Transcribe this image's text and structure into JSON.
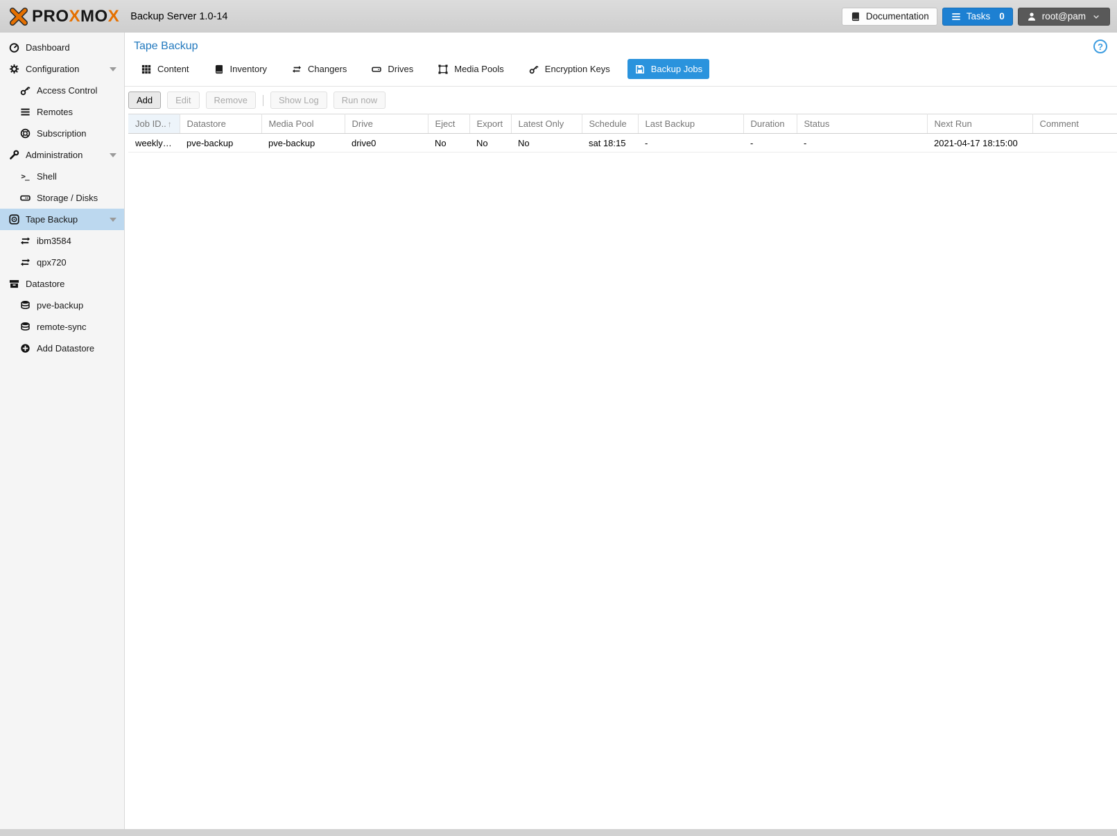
{
  "topbar": {
    "brand_p1": "PR",
    "brand_o1": "O",
    "brand_x1": "X",
    "brand_m": "M",
    "brand_o2": "O",
    "brand_x2": "X",
    "app_title": "Backup Server 1.0-14",
    "documentation_label": "Documentation",
    "tasks_label": "Tasks",
    "tasks_count": "0",
    "user_label": "root@pam"
  },
  "sidebar": {
    "items": [
      {
        "label": "Dashboard",
        "icon": "dashboard-icon"
      },
      {
        "label": "Configuration",
        "icon": "gear-icon",
        "expandable": true
      },
      {
        "label": "Access Control",
        "icon": "key-icon"
      },
      {
        "label": "Remotes",
        "icon": "list-icon"
      },
      {
        "label": "Subscription",
        "icon": "life-ring-icon"
      },
      {
        "label": "Administration",
        "icon": "wrench-icon",
        "expandable": true
      },
      {
        "label": "Shell",
        "icon": "terminal-icon"
      },
      {
        "label": "Storage / Disks",
        "icon": "hdd-icon"
      },
      {
        "label": "Tape Backup",
        "icon": "tape-icon",
        "expandable": true,
        "selected": true
      },
      {
        "label": "ibm3584",
        "icon": "exchange-icon"
      },
      {
        "label": "qpx720",
        "icon": "exchange-icon"
      },
      {
        "label": "Datastore",
        "icon": "archive-icon"
      },
      {
        "label": "pve-backup",
        "icon": "database-icon"
      },
      {
        "label": "remote-sync",
        "icon": "database-icon"
      },
      {
        "label": "Add Datastore",
        "icon": "plus-circle-icon"
      }
    ]
  },
  "main": {
    "title": "Tape Backup",
    "tabs": [
      {
        "label": "Content",
        "icon": "grid-icon",
        "active": false
      },
      {
        "label": "Inventory",
        "icon": "book-icon",
        "active": false
      },
      {
        "label": "Changers",
        "icon": "exchange-icon",
        "active": false
      },
      {
        "label": "Drives",
        "icon": "hdd-icon",
        "active": false
      },
      {
        "label": "Media Pools",
        "icon": "object-group-icon",
        "active": false
      },
      {
        "label": "Encryption Keys",
        "icon": "key-icon",
        "active": false
      },
      {
        "label": "Backup Jobs",
        "icon": "save-icon",
        "active": true
      }
    ],
    "toolbar": {
      "add_label": "Add",
      "edit_label": "Edit",
      "remove_label": "Remove",
      "show_log_label": "Show Log",
      "run_now_label": "Run now"
    },
    "grid": {
      "sorted_column": "Job ID..",
      "sort_direction": "asc",
      "columns": [
        "Job ID..",
        "Datastore",
        "Media Pool",
        "Drive",
        "Eject",
        "Export",
        "Latest Only",
        "Schedule",
        "Last Backup",
        "Duration",
        "Status",
        "Next Run",
        "Comment"
      ],
      "rows": [
        [
          "weekly…",
          "pve-backup",
          "pve-backup",
          "drive0",
          "No",
          "No",
          "No",
          "sat 18:15",
          "-",
          "-",
          "-",
          "2021-04-17 18:15:00",
          ""
        ]
      ]
    }
  },
  "colors": {
    "brand_orange": "#e57000",
    "accent_blue": "#2a93dd",
    "tasks_blue": "#1d80d2",
    "selection_blue": "#bcd8ef",
    "title_blue": "#2279be",
    "topbar_gray": "#d5d5d5",
    "sidebar_gray": "#f5f5f5"
  }
}
